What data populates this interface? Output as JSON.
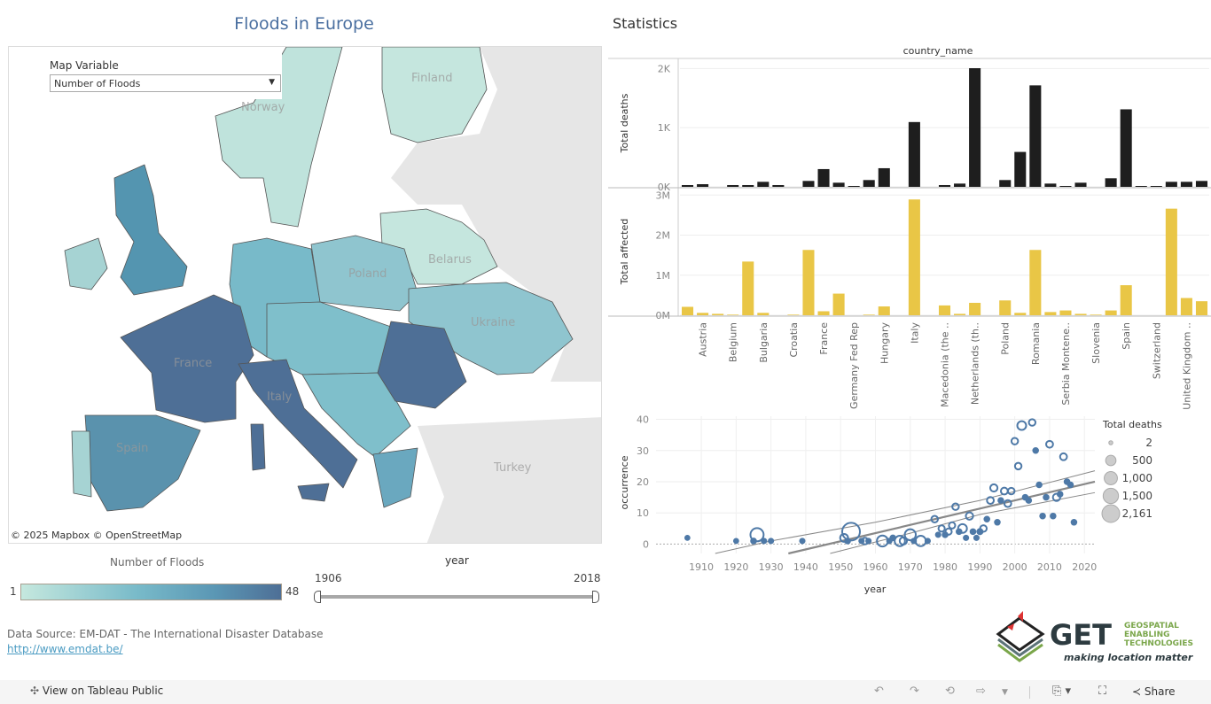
{
  "header": {
    "title": "Floods in Europe",
    "stats_title": "Statistics"
  },
  "map": {
    "variable_label": "Map Variable",
    "variable_value": "Number of Floods",
    "attribution": "© 2025 Mapbox  © OpenStreetMap",
    "country_labels": [
      "Finland",
      "Norway",
      "Belarus",
      "Poland",
      "Ukraine",
      "France",
      "Italy",
      "Spain",
      "Turkey"
    ],
    "colors": {
      "low": "#c5e8de",
      "mid": "#78bac9",
      "high": "#4e6f96"
    }
  },
  "color_legend": {
    "title": "Number of Floods",
    "min": "1",
    "max": "48"
  },
  "year_filter": {
    "title": "year",
    "min": "1906",
    "max": "2018"
  },
  "source": {
    "text": "Data Source: EM-DAT - The International Disaster Database",
    "link": "http://www.emdat.be/"
  },
  "logo": {
    "text": "GET",
    "subtitle": "GEOSPATIAL ENABLING TECHNOLOGIES",
    "tagline": "making location matter"
  },
  "toolbar": {
    "view_label": "View on Tableau Public",
    "share_label": "Share"
  },
  "chart_data": [
    {
      "type": "bar",
      "column_header": "country_name",
      "categories": [
        "",
        "Austria",
        "",
        "Belgium",
        "",
        "Bulgaria",
        "",
        "Croatia",
        "",
        "France",
        "",
        "Germany Fed Rep",
        "",
        "Hungary",
        "",
        "Italy",
        "",
        "Macedonia (the ..",
        "",
        "Netherlands (th..",
        "",
        "Poland",
        "",
        "Romania",
        "",
        "Serbia Montene..",
        "",
        "Slovenia",
        "",
        "Spain",
        "",
        "Switzerland",
        "",
        "United Kingdom ..",
        ""
      ],
      "series": [
        {
          "name": "Total deaths",
          "color": "#1e1e1e",
          "ticks": [
            "0K",
            "1K",
            "2K"
          ],
          "ylim": [
            0,
            2050
          ],
          "values": [
            30,
            45,
            0,
            30,
            30,
            85,
            30,
            0,
            100,
            300,
            70,
            15,
            115,
            315,
            0,
            1095,
            0,
            30,
            55,
            2005,
            0,
            115,
            590,
            1715,
            55,
            15,
            70,
            0,
            145,
            1310,
            15,
            15,
            85,
            85,
            100
          ]
        },
        {
          "name": "Total affected",
          "color": "#e9c646",
          "ticks": [
            "0M",
            "1M",
            "2M",
            "3M"
          ],
          "ylim": [
            0,
            3050000
          ],
          "values": [
            210000,
            60000,
            35000,
            15000,
            1340000,
            60000,
            0,
            15000,
            1630000,
            100000,
            540000,
            0,
            15000,
            220000,
            0,
            2890000,
            0,
            245000,
            35000,
            310000,
            0,
            370000,
            60000,
            1630000,
            80000,
            120000,
            35000,
            15000,
            120000,
            750000,
            0,
            0,
            2660000,
            430000,
            350000
          ]
        }
      ]
    },
    {
      "type": "scatter",
      "xlabel": "year",
      "ylabel": "occurrence",
      "xticks": [
        "1910",
        "1920",
        "1930",
        "1940",
        "1950",
        "1960",
        "1970",
        "1980",
        "1990",
        "2000",
        "2010",
        "2020"
      ],
      "yticks": [
        "0",
        "10",
        "20",
        "30",
        "40"
      ],
      "xlim": [
        1897,
        2023
      ],
      "ylim": [
        -3,
        41
      ],
      "color": "#4e79a7",
      "size_legend": {
        "title": "Total deaths",
        "values": [
          "2",
          "500",
          "1,000",
          "1,500",
          "2,161"
        ]
      },
      "points": [
        [
          1906,
          2,
          5
        ],
        [
          1920,
          1,
          5
        ],
        [
          1925,
          1,
          20
        ],
        [
          1926,
          3,
          1000
        ],
        [
          1928,
          1,
          10
        ],
        [
          1930,
          1,
          10
        ],
        [
          1939,
          1,
          10
        ],
        [
          1951,
          2,
          200
        ],
        [
          1952,
          1,
          20
        ],
        [
          1953,
          4,
          2161
        ],
        [
          1956,
          1,
          10
        ],
        [
          1957,
          1,
          100
        ],
        [
          1958,
          1,
          10
        ],
        [
          1962,
          1,
          600
        ],
        [
          1964,
          1,
          10
        ],
        [
          1965,
          2,
          20
        ],
        [
          1967,
          1,
          500
        ],
        [
          1968,
          1,
          150
        ],
        [
          1970,
          3,
          600
        ],
        [
          1971,
          1,
          10
        ],
        [
          1973,
          1,
          500
        ],
        [
          1975,
          1,
          10
        ],
        [
          1977,
          8,
          100
        ],
        [
          1978,
          3,
          10
        ],
        [
          1979,
          5,
          80
        ],
        [
          1980,
          3,
          20
        ],
        [
          1981,
          4,
          80
        ],
        [
          1982,
          6,
          80
        ],
        [
          1983,
          12,
          100
        ],
        [
          1984,
          4,
          20
        ],
        [
          1985,
          5,
          300
        ],
        [
          1986,
          2,
          10
        ],
        [
          1987,
          9,
          150
        ],
        [
          1988,
          4,
          20
        ],
        [
          1989,
          2,
          10
        ],
        [
          1990,
          4,
          30
        ],
        [
          1991,
          5,
          100
        ],
        [
          1992,
          8,
          20
        ],
        [
          1993,
          14,
          120
        ],
        [
          1994,
          18,
          150
        ],
        [
          1995,
          7,
          20
        ],
        [
          1996,
          14,
          20
        ],
        [
          1997,
          17,
          120
        ],
        [
          1998,
          13,
          120
        ],
        [
          1999,
          17,
          100
        ],
        [
          2000,
          33,
          100
        ],
        [
          2001,
          25,
          100
        ],
        [
          2002,
          38,
          300
        ],
        [
          2003,
          15,
          20
        ],
        [
          2004,
          14,
          20
        ],
        [
          2005,
          39,
          100
        ],
        [
          2006,
          30,
          20
        ],
        [
          2007,
          19,
          20
        ],
        [
          2008,
          9,
          20
        ],
        [
          2009,
          15,
          20
        ],
        [
          2010,
          32,
          120
        ],
        [
          2011,
          9,
          20
        ],
        [
          2012,
          15,
          150
        ],
        [
          2013,
          16,
          20
        ],
        [
          2014,
          28,
          120
        ],
        [
          2015,
          20,
          20
        ],
        [
          2016,
          19,
          20
        ],
        [
          2017,
          7,
          20
        ]
      ],
      "trend": {
        "center": [
          [
            1935,
            -3
          ],
          [
            2023,
            20
          ]
        ],
        "upper": [
          [
            1914,
            -3
          ],
          [
            1930,
            1
          ],
          [
            1960,
            7
          ],
          [
            1990,
            14
          ],
          [
            2023,
            23.5
          ]
        ],
        "lower": [
          [
            1947,
            -3
          ],
          [
            1970,
            3.5
          ],
          [
            1990,
            9.5
          ],
          [
            2023,
            16.5
          ]
        ]
      }
    }
  ]
}
